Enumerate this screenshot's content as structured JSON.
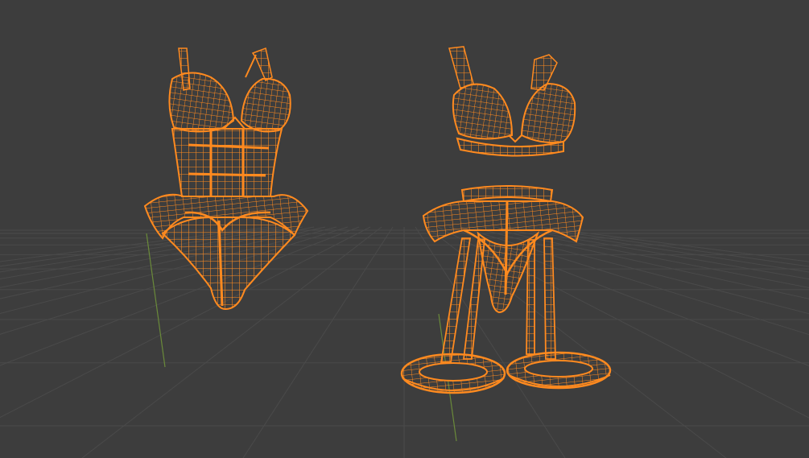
{
  "viewport": {
    "name": "3D Viewport",
    "mode": "wireframe",
    "colors": {
      "background": "#3d3d3d",
      "grid_line": "#4a4a4a",
      "y_axis": "#6a8a3a",
      "selected_wire": "#ff8a1f",
      "selected_wire_dark": "#e06a0a"
    }
  },
  "objects": [
    {
      "id": "bodysuit",
      "label": ""
    },
    {
      "id": "bra",
      "label": ""
    },
    {
      "id": "garter-set",
      "label": ""
    }
  ]
}
